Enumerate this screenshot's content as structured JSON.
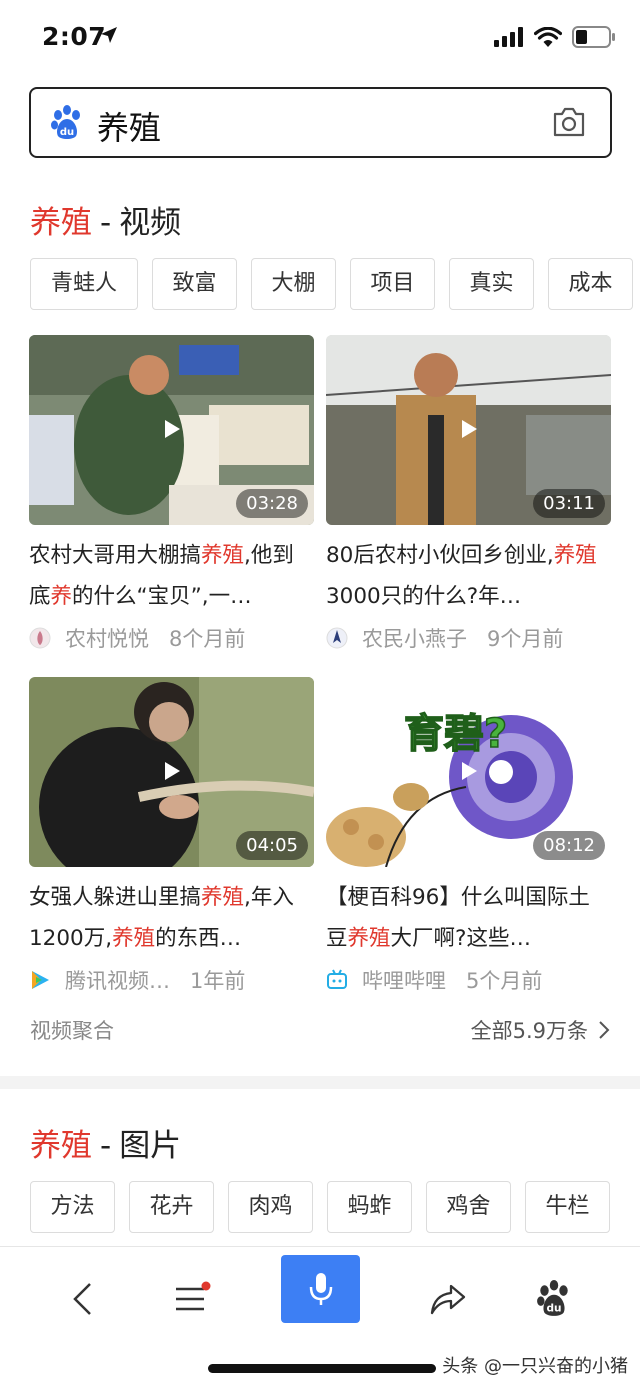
{
  "status_bar": {
    "time": "2:07"
  },
  "search": {
    "query": "养殖",
    "logo_icon": "baidu-paw-icon",
    "camera_icon": "camera-icon"
  },
  "video_section": {
    "keyword": "养殖",
    "separator": "-",
    "title": "视频",
    "chips": [
      "青蛙人",
      "致富",
      "大棚",
      "项目",
      "真实",
      "成本"
    ],
    "videos": [
      {
        "duration": "03:28",
        "title_parts": [
          {
            "text": "农村大哥用大棚搞",
            "highlight": false
          },
          {
            "text": "养殖",
            "highlight": true
          },
          {
            "text": ",他到底",
            "highlight": false
          },
          {
            "text": "养",
            "highlight": true
          },
          {
            "text": "的什么“宝贝”,一…",
            "highlight": false
          }
        ],
        "source": "农村悦悦",
        "time": "8个月前"
      },
      {
        "duration": "03:11",
        "title_parts": [
          {
            "text": "80后农村小伙回乡创业,",
            "highlight": false
          },
          {
            "text": "养殖",
            "highlight": true
          },
          {
            "text": "3000只的什么?年…",
            "highlight": false
          }
        ],
        "source": "农民小燕子",
        "time": "9个月前"
      },
      {
        "duration": "04:05",
        "title_parts": [
          {
            "text": "女强人躲进山里搞",
            "highlight": false
          },
          {
            "text": "养殖",
            "highlight": true
          },
          {
            "text": ",年入1200万,",
            "highlight": false
          },
          {
            "text": "养殖",
            "highlight": true
          },
          {
            "text": "的东西…",
            "highlight": false
          }
        ],
        "source": "腾讯视频…",
        "time": "1年前"
      },
      {
        "duration": "08:12",
        "title_parts": [
          {
            "text": "【梗百科96】什么叫国际土豆",
            "highlight": false
          },
          {
            "text": "养殖",
            "highlight": true
          },
          {
            "text": "大厂啊?这些…",
            "highlight": false
          }
        ],
        "source": "哔哩哔哩",
        "time": "5个月前",
        "thumb_text": "育碧?"
      }
    ],
    "footer_left": "视频聚合",
    "footer_right": "全部5.9万条"
  },
  "image_section": {
    "keyword": "养殖",
    "separator": "-",
    "title": "图片",
    "chips": [
      "方法",
      "花卉",
      "肉鸡",
      "蚂蚱",
      "鸡舍",
      "牛栏"
    ]
  },
  "toolbar": {
    "items": [
      "back-icon",
      "menu-icon",
      "microphone-icon",
      "share-icon",
      "baidu-paw-icon"
    ],
    "accent_color": "#3d7ff4",
    "notification_dot_color": "#e0382d"
  },
  "watermark": "头条 @一只兴奋的小猪",
  "colors": {
    "highlight": "#e0382d",
    "text": "#222222",
    "muted": "#9a9a9a"
  }
}
